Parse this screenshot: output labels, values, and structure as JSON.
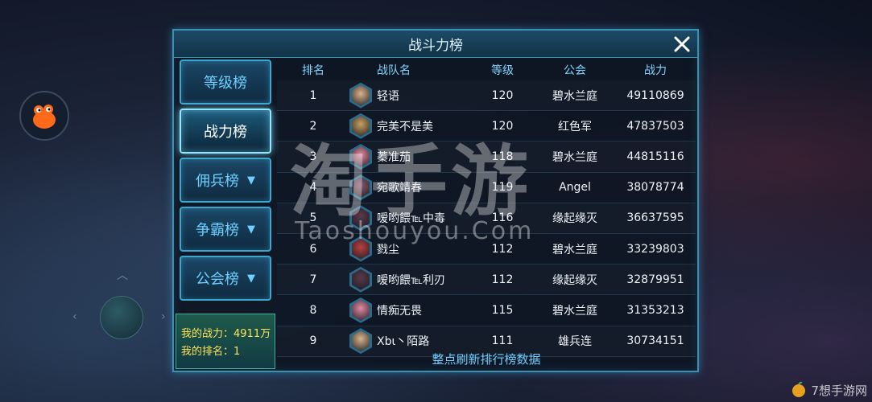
{
  "panel": {
    "title": "战斗力榜",
    "footer_note": "整点刷新排行榜数据"
  },
  "tabs": [
    {
      "label": "等级榜",
      "active": false,
      "dropdown": false
    },
    {
      "label": "战力榜",
      "active": true,
      "dropdown": false
    },
    {
      "label": "佣兵榜",
      "active": false,
      "dropdown": true
    },
    {
      "label": "争霸榜",
      "active": false,
      "dropdown": true
    },
    {
      "label": "公会榜",
      "active": false,
      "dropdown": true
    }
  ],
  "dropdown_glyph": "▼",
  "my_stats": {
    "power_line": "我的战力：4911万",
    "rank_line": "我的排名：1"
  },
  "table": {
    "headers": {
      "rank": "排名",
      "name": "战队名",
      "level": "等级",
      "guild": "公会",
      "power": "战力"
    },
    "rows": [
      {
        "rank": "1",
        "name": "轻语",
        "level": "120",
        "guild": "碧水兰庭",
        "power": "49110869",
        "avatar_color": "#d9b48a"
      },
      {
        "rank": "2",
        "name": "完美不是美",
        "level": "120",
        "guild": "红色军",
        "power": "47837503",
        "avatar_color": "#c9a060"
      },
      {
        "rank": "3",
        "name": "蓁准茄",
        "level": "118",
        "guild": "碧水兰庭",
        "power": "44815116",
        "avatar_color": "#e58aa0"
      },
      {
        "rank": "4",
        "name": "宛歌靖春",
        "level": "119",
        "guild": "Angel",
        "power": "38078774",
        "avatar_color": "#8a5a6a"
      },
      {
        "rank": "5",
        "name": "嗳哟餵℡中毒",
        "level": "116",
        "guild": "缘起缘灭",
        "power": "36637595",
        "avatar_color": "#5a3a4a"
      },
      {
        "rank": "6",
        "name": "戮尘",
        "level": "112",
        "guild": "碧水兰庭",
        "power": "33239803",
        "avatar_color": "#b84040"
      },
      {
        "rank": "7",
        "name": "嗳哟餵℡利刃",
        "level": "112",
        "guild": "缘起缘灭",
        "power": "32879951",
        "avatar_color": "#5a3a4a"
      },
      {
        "rank": "8",
        "name": "情痴无畏",
        "level": "115",
        "guild": "碧水兰庭",
        "power": "31353213",
        "avatar_color": "#e58aa0"
      },
      {
        "rank": "9",
        "name": "Xbι丶陌路",
        "level": "111",
        "guild": "雄兵连",
        "power": "30734151",
        "avatar_color": "#d9b48a"
      }
    ]
  },
  "watermark": {
    "main": "淘手游",
    "sub": "Taoshouyou.Com",
    "corner": "7想手游网"
  },
  "colors": {
    "accent": "#3aa7cf",
    "highlight": "#ffe45a",
    "header_text": "#7ed6ff"
  }
}
